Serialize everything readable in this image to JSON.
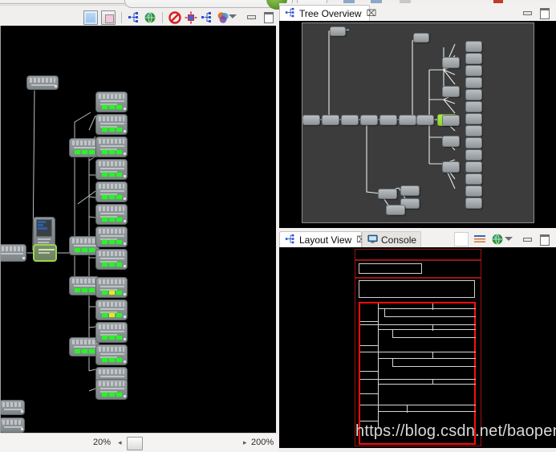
{
  "window": {
    "theme_bg": "#f0efee",
    "canvas_bg": "#000000",
    "tree_bg": "#3c3c3c",
    "accent_green": "#2ef02e",
    "select_green": "#9bd64a",
    "layout_red": "#fb0d0d"
  },
  "editor": {
    "toolbar": {
      "icons": [
        {
          "name": "page-icon",
          "label": "Show Page"
        },
        {
          "name": "layers-icon",
          "label": "Show Layers"
        },
        {
          "name": "tree-nodes-icon",
          "label": "Tree Layout"
        },
        {
          "name": "globe-icon",
          "label": "Global View"
        },
        {
          "name": "no-entry-icon",
          "label": "Disable"
        },
        {
          "name": "focus-nodes-icon",
          "label": "Focus Selection"
        },
        {
          "name": "tree-nodes-2-icon",
          "label": "Expand Tree"
        },
        {
          "name": "venn-icon",
          "label": "Overlay"
        }
      ],
      "view_menu_label": "View Menu",
      "minimize_label": "Minimize",
      "maximize_label": "Maximize"
    },
    "status": {
      "zoom_min": "20%",
      "zoom_max": "200%",
      "left_arrow": "◂",
      "right_arrow": "▸"
    }
  },
  "tree_overview": {
    "tab_label": "Tree Overview",
    "tab_icon": "tree-nodes-icon",
    "close_glyph": "⌧",
    "minimize_label": "Minimize",
    "maximize_label": "Maximize"
  },
  "layout_view": {
    "tabs": [
      {
        "label": "Layout View",
        "icon": "tree-nodes-icon",
        "active": true,
        "closable": true
      },
      {
        "label": "Console",
        "icon": "console-icon",
        "active": false,
        "closable": false
      }
    ],
    "close_glyph": "⌧",
    "toolbar": {
      "icons": [
        {
          "name": "blank-page-icon",
          "label": "New"
        },
        {
          "name": "list-lines-icon",
          "label": "Properties"
        },
        {
          "name": "globe-icon",
          "label": "Open Browser"
        }
      ],
      "view_menu_label": "View Menu",
      "minimize_label": "Minimize",
      "maximize_label": "Maximize"
    },
    "watermark": "https://blog.csdn.net/baopengjian"
  },
  "graph": {
    "node_count_visible": 34,
    "selected_node_index": 12,
    "status_indicator_color": "#2ef02e",
    "warning_indicator_color": "#e8e81c"
  }
}
